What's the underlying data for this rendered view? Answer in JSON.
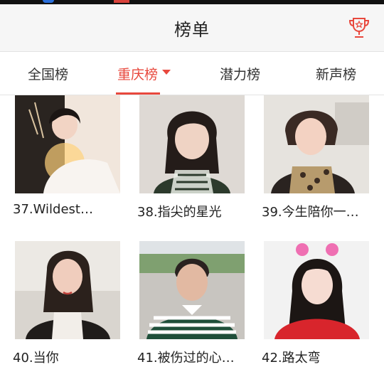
{
  "header": {
    "title": "榜单",
    "trophy_icon": "trophy-icon"
  },
  "tabs": [
    {
      "label": "全国榜",
      "active": false
    },
    {
      "label": "重庆榜",
      "active": true
    },
    {
      "label": "潜力榜",
      "active": false
    },
    {
      "label": "新声榜",
      "active": false
    }
  ],
  "accent_color": "#e8483d",
  "cards": [
    {
      "caption": "37.Wildest…"
    },
    {
      "caption": "38.指尖的星光"
    },
    {
      "caption": "39.今生陪你一…"
    },
    {
      "caption": "40.当你"
    },
    {
      "caption": "41.被伤过的心…"
    },
    {
      "caption": "42.路太弯"
    }
  ]
}
